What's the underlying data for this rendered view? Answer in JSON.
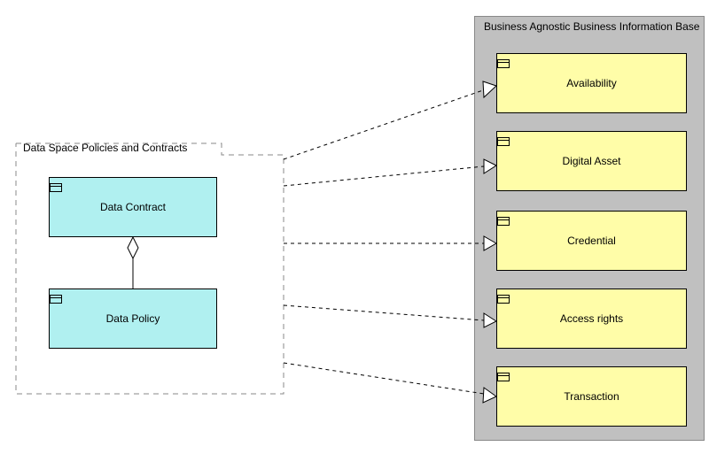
{
  "leftGroup": {
    "title": "Data Space Policies and Contracts"
  },
  "rightGroup": {
    "title": "Business Agnostic Business Information Base"
  },
  "leftElements": {
    "dataContract": "Data Contract",
    "dataPolicy": "Data Policy"
  },
  "rightElements": {
    "availability": "Availability",
    "digitalAsset": "Digital Asset",
    "credential": "Credential",
    "accessRights": "Access rights",
    "transaction": "Transaction"
  }
}
